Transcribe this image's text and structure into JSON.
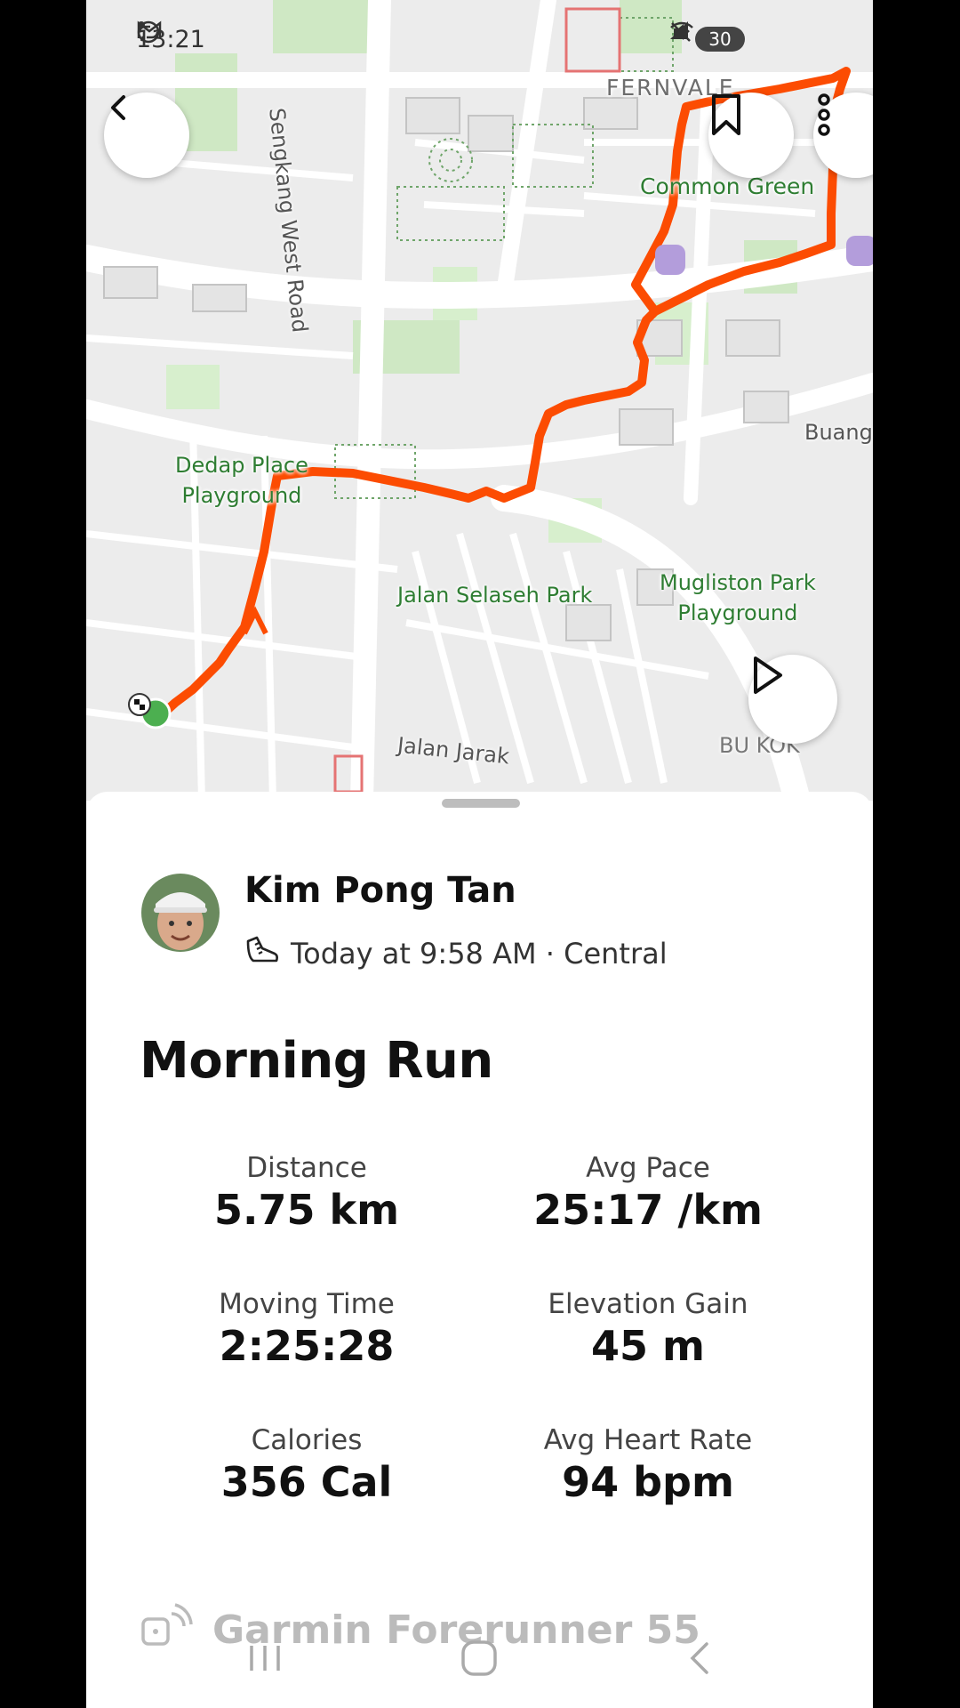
{
  "status_bar": {
    "time": "13:21",
    "battery": "30"
  },
  "map": {
    "labels": {
      "fernvale": "FERNVALE",
      "common_green": "Common Green",
      "dedap_line1": "Dedap Place",
      "dedap_line2": "Playground",
      "jalan_selaseh": "Jalan Selaseh Park",
      "mugliston_line1": "Mugliston Park",
      "mugliston_line2": "Playground",
      "sengkang_west": "Sengkang West Road",
      "jalan_jarak": "Jalan Jarak",
      "buang": "Buang",
      "bu_kok": "BU   KOK"
    },
    "route_color": "#fc4c02",
    "start_color": "#4caf50"
  },
  "header_buttons": {
    "back": "back",
    "bookmark": "bookmark",
    "more": "more"
  },
  "athlete": {
    "name": "Kim Pong Tan",
    "meta": "Today at 9:58 AM · Central"
  },
  "activity": {
    "title": "Morning Run",
    "stats": [
      {
        "label": "Distance",
        "value": "5.75 km"
      },
      {
        "label": "Avg Pace",
        "value": "25:17 /km"
      },
      {
        "label": "Moving Time",
        "value": "2:25:28"
      },
      {
        "label": "Elevation Gain",
        "value": "45 m"
      },
      {
        "label": "Calories",
        "value": "356 Cal"
      },
      {
        "label": "Avg Heart Rate",
        "value": "94 bpm"
      }
    ],
    "device": "Garmin Forerunner 55"
  }
}
